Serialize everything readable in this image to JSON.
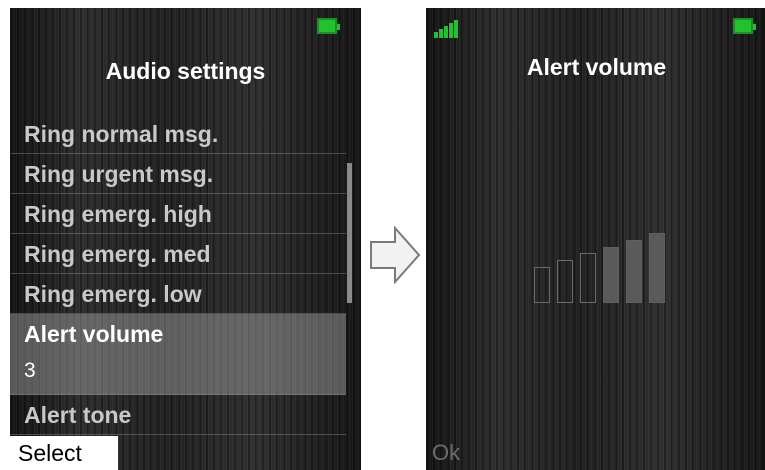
{
  "left_screen": {
    "title": "Audio settings",
    "menu_items": [
      {
        "label": "Ring normal msg."
      },
      {
        "label": "Ring urgent msg."
      },
      {
        "label": "Ring emerg. high"
      },
      {
        "label": "Ring emerg. med"
      },
      {
        "label": "Ring emerg. low"
      },
      {
        "label": "Alert volume",
        "value": "3",
        "selected": true
      },
      {
        "label": "Alert tone"
      }
    ],
    "softkey_left": "Select",
    "battery_icon": "battery-full-icon",
    "colors": {
      "battery": "#22c12f",
      "selection": "#a8a8a8"
    }
  },
  "transition_icon": "arrow-right-outline-icon",
  "right_screen": {
    "title": "Alert volume",
    "softkey_left": "Ok",
    "signal_icon": "signal-strength-icon",
    "battery_icon": "battery-full-icon",
    "volume": {
      "level": 3,
      "max": 6
    }
  }
}
